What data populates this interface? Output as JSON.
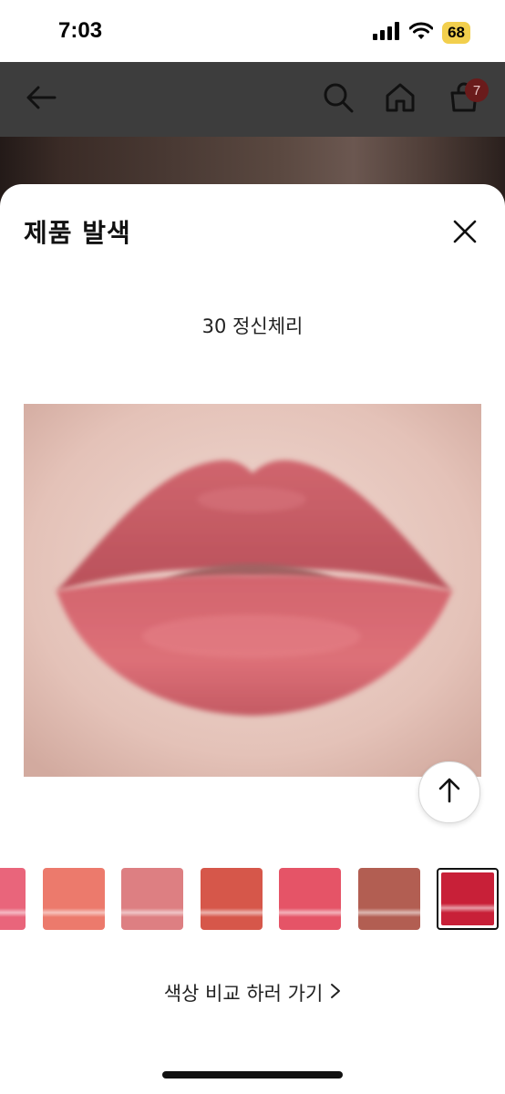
{
  "status_bar": {
    "time": "7:03",
    "battery": "68"
  },
  "header": {
    "cart_count": "7"
  },
  "sheet": {
    "title": "제품 발색",
    "shade_name": "30 정신체리",
    "compare_link": "색상 비교 하러 가기"
  },
  "swatches": [
    {
      "color": "#e9657b",
      "selected": false
    },
    {
      "color": "#ec7a6c",
      "selected": false
    },
    {
      "color": "#dd7f82",
      "selected": false
    },
    {
      "color": "#d6574a",
      "selected": false
    },
    {
      "color": "#e55467",
      "selected": false
    },
    {
      "color": "#b25e52",
      "selected": false
    },
    {
      "color": "#c82038",
      "selected": true
    }
  ],
  "icons": [
    "back-arrow-icon",
    "search-icon",
    "home-icon",
    "cart-icon",
    "close-icon",
    "arrow-up-icon",
    "chevron-right-icon"
  ]
}
